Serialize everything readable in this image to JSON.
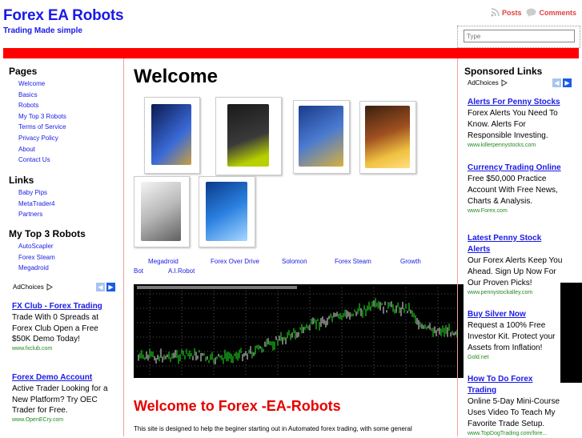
{
  "header": {
    "site_title": "Forex EA Robots",
    "tagline": "Trading Made simple",
    "posts_label": "Posts",
    "comments_label": "Comments",
    "search_placeholder": "Type"
  },
  "sidebar_left": {
    "pages_title": "Pages",
    "pages": [
      "Welcome",
      "Basics",
      "Robots",
      "My Top 3 Robots",
      "Terms of Service",
      "Privacy Policy",
      "About",
      "Contact Us"
    ],
    "links_title": "Links",
    "links": [
      "Baby Pips",
      "MetaTrader4",
      "Partners"
    ],
    "top3_title": "My Top 3 Robots",
    "top3": [
      "AutoScapler",
      "Forex Steam",
      "Megadroid"
    ],
    "adchoices_label": "AdChoices",
    "ads": [
      {
        "title": "FX Club - Forex Trading",
        "body": "Trade With 0 Spreads at Forex Club Open a Free $50K Demo Today!",
        "url": "www.fxclub.com"
      },
      {
        "title": "Forex Demo Account",
        "body": "Active Trader Looking for a New Platform? Try OEC Trader for Free.",
        "url": "www.OpenECry.com"
      }
    ]
  },
  "sidebar_right": {
    "title": "Sponsored Links",
    "adchoices_label": "AdChoices",
    "ads": [
      {
        "title": "Alerts For Penny Stocks",
        "body": "Forex Alerts You Need To Know. Alerts For Responsible Investing.",
        "url": "www.killerpennystocks.com"
      },
      {
        "title": "Currency Trading Online",
        "body": "Free $50,000 Practice Account With Free News, Charts & Analysis.",
        "url": "www.Forex.com"
      },
      {
        "title": "Latest Penny Stock Alerts",
        "body": "Our Forex Alerts Keep You Ahead. Sign Up Now For Our Proven Picks!",
        "url": "www.pennystockalley.com"
      },
      {
        "title": "Buy Silver Now",
        "body": "Request a 100% Free Investor Kit. Protect your Assets from Inflation!",
        "url": "Gold.net"
      },
      {
        "title": "How To Do Forex Trading",
        "body": "Online 5-Day Mini-Course Uses Video To Teach My Favorite Trade Setup.",
        "url": "www.TopDogTrading.com/fore..."
      }
    ]
  },
  "main": {
    "title": "Welcome",
    "captions_line1": [
      "Megadroid",
      "Forex Over Drive",
      "Solomon",
      "Forex Steam",
      "Growth"
    ],
    "captions_line2": [
      "Bot",
      "A.I.Robot"
    ],
    "welcome_heading": "Welcome to Forex -EA-Robots",
    "intro": "This site is designed to help the beginer starting out in Automated forex trading, with some general"
  },
  "colors": {
    "link": "#1a1ae6",
    "accent_red": "#ff0000",
    "heading_red": "#e60000",
    "url_green": "#228822"
  },
  "icons": [
    "rss-feed-icon",
    "comment-bubble-icon",
    "adchoices-icon",
    "chevron-left-icon",
    "chevron-right-icon"
  ]
}
